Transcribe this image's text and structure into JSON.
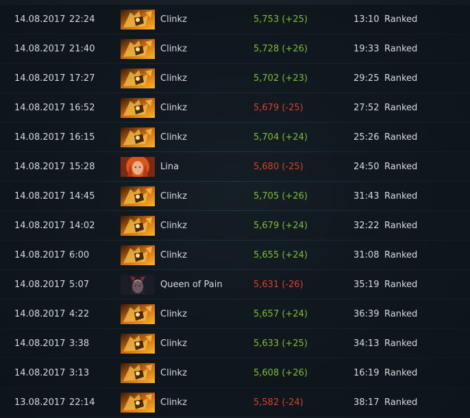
{
  "colors": {
    "win": "#7fbd3a",
    "loss": "#d8412f",
    "text": "#d6dbe0"
  },
  "matches": [
    {
      "date": "14.08.2017",
      "time": "22:24",
      "hero": "Clinkz",
      "hero_icon": "clinkz-portrait-icon",
      "mmr": "5,753 (+25)",
      "result": "win",
      "duration": "13:10",
      "mode": "Ranked"
    },
    {
      "date": "14.08.2017",
      "time": "21:40",
      "hero": "Clinkz",
      "hero_icon": "clinkz-portrait-icon",
      "mmr": "5,728 (+26)",
      "result": "win",
      "duration": "19:33",
      "mode": "Ranked"
    },
    {
      "date": "14.08.2017",
      "time": "17:27",
      "hero": "Clinkz",
      "hero_icon": "clinkz-portrait-icon",
      "mmr": "5,702 (+23)",
      "result": "win",
      "duration": "29:25",
      "mode": "Ranked"
    },
    {
      "date": "14.08.2017",
      "time": "16:52",
      "hero": "Clinkz",
      "hero_icon": "clinkz-portrait-icon",
      "mmr": "5,679 (-25)",
      "result": "loss",
      "duration": "27:52",
      "mode": "Ranked"
    },
    {
      "date": "14.08.2017",
      "time": "16:15",
      "hero": "Clinkz",
      "hero_icon": "clinkz-portrait-icon",
      "mmr": "5,704 (+24)",
      "result": "win",
      "duration": "25:26",
      "mode": "Ranked"
    },
    {
      "date": "14.08.2017",
      "time": "15:28",
      "hero": "Lina",
      "hero_icon": "lina-portrait-icon",
      "mmr": "5,680 (-25)",
      "result": "loss",
      "duration": "24:50",
      "mode": "Ranked"
    },
    {
      "date": "14.08.2017",
      "time": "14:45",
      "hero": "Clinkz",
      "hero_icon": "clinkz-portrait-icon",
      "mmr": "5,705 (+26)",
      "result": "win",
      "duration": "31:43",
      "mode": "Ranked"
    },
    {
      "date": "14.08.2017",
      "time": "14:02",
      "hero": "Clinkz",
      "hero_icon": "clinkz-portrait-icon",
      "mmr": "5,679 (+24)",
      "result": "win",
      "duration": "32:22",
      "mode": "Ranked"
    },
    {
      "date": "14.08.2017",
      "time": "6:00",
      "hero": "Clinkz",
      "hero_icon": "clinkz-portrait-icon",
      "mmr": "5,655 (+24)",
      "result": "win",
      "duration": "31:08",
      "mode": "Ranked"
    },
    {
      "date": "14.08.2017",
      "time": "5:07",
      "hero": "Queen of Pain",
      "hero_icon": "queen-of-pain-portrait-icon",
      "mmr": "5,631 (-26)",
      "result": "loss",
      "duration": "35:19",
      "mode": "Ranked"
    },
    {
      "date": "14.08.2017",
      "time": "4:22",
      "hero": "Clinkz",
      "hero_icon": "clinkz-portrait-icon",
      "mmr": "5,657 (+24)",
      "result": "win",
      "duration": "36:39",
      "mode": "Ranked"
    },
    {
      "date": "14.08.2017",
      "time": "3:38",
      "hero": "Clinkz",
      "hero_icon": "clinkz-portrait-icon",
      "mmr": "5,633 (+25)",
      "result": "win",
      "duration": "34:13",
      "mode": "Ranked"
    },
    {
      "date": "14.08.2017",
      "time": "3:13",
      "hero": "Clinkz",
      "hero_icon": "clinkz-portrait-icon",
      "mmr": "5,608 (+26)",
      "result": "win",
      "duration": "16:19",
      "mode": "Ranked"
    },
    {
      "date": "13.08.2017",
      "time": "22:14",
      "hero": "Clinkz",
      "hero_icon": "clinkz-portrait-icon",
      "mmr": "5,582 (-24)",
      "result": "loss",
      "duration": "38:17",
      "mode": "Ranked"
    }
  ]
}
